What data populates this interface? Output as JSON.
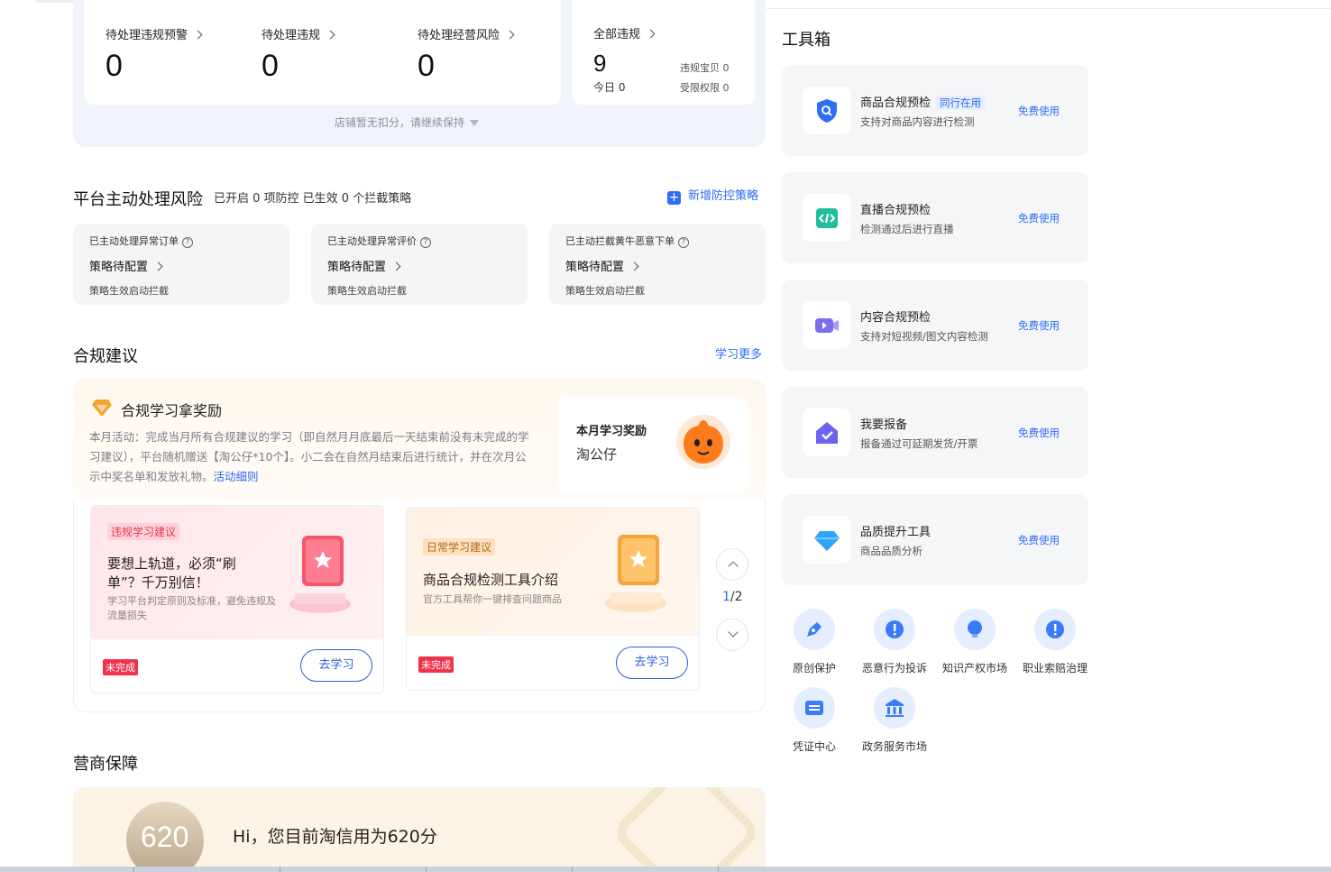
{
  "stats": {
    "items": [
      {
        "label": "待处理违规预警",
        "value": "0"
      },
      {
        "label": "待处理违规",
        "value": "0"
      },
      {
        "label": "待处理经营风险",
        "value": "0"
      }
    ],
    "all_violations": {
      "label": "全部违规",
      "value": "9",
      "today": "今日 0",
      "items_violation": "违规宝贝 0",
      "restricted": "受限权限 0"
    },
    "note": "店铺暂无扣分，请继续保持"
  },
  "platform": {
    "title": "平台主动处理风险",
    "subtitle": "已开启 0 项防控 已生效 0 个拦截策略",
    "add_link": "新增防控策略",
    "cards": [
      {
        "title": "已主动处理异常订单",
        "status": "策略待配置",
        "desc": "策略生效启动拦截"
      },
      {
        "title": "已主动处理异常评价",
        "status": "策略待配置",
        "desc": "策略生效启动拦截"
      },
      {
        "title": "已主动拦截黄牛恶意下单",
        "status": "策略待配置",
        "desc": "策略生效启动拦截"
      }
    ]
  },
  "suggestions": {
    "title": "合规建议",
    "more_link": "学习更多",
    "reward_title": "合规学习拿奖励",
    "reward_text": "本月活动：完成当月所有合规建议的学习（即自然月月底最后一天结束前没有未完成的学习建议），平台随机赠送【淘公仔*10个】。小二会在自然月结束后进行统计，并在次月公示中奖名单和发放礼物。",
    "reward_link": "活动细则",
    "monthly_label": "本月学习奖励",
    "monthly_value": "淘公仔",
    "cards": [
      {
        "tag": "违规学习建议",
        "title": "要想上轨道，必须“刷单”？千万别信！",
        "desc": "学习平台判定原则及标准，避免违规及流量损失",
        "status": "未完成",
        "button": "去学习"
      },
      {
        "tag": "日常学习建议",
        "title": "商品合规检测工具介绍",
        "desc": "官方工具帮你一键排查问题商品",
        "status": "未完成",
        "button": "去学习"
      }
    ],
    "pager_current": "1",
    "pager_total": "/2"
  },
  "business": {
    "title": "营商保障",
    "score": "620",
    "greeting": "Hi，您目前淘信用为620分"
  },
  "toolbox": {
    "title": "工具箱",
    "tools": [
      {
        "name": "商品合规预检",
        "tag": "同行在用",
        "desc": "支持对商品内容进行检测",
        "link": "免费使用",
        "icon": "shield-search-icon",
        "color": "#2d6cf6"
      },
      {
        "name": "直播合规预检",
        "tag": "",
        "desc": "检测通过后进行直播",
        "link": "免费使用",
        "icon": "code-icon",
        "color": "#1fbf9a"
      },
      {
        "name": "内容合规预检",
        "tag": "",
        "desc": "支持对短视频/图文内容检测",
        "link": "免费使用",
        "icon": "video-icon",
        "color": "#7b6cf0"
      },
      {
        "name": "我要报备",
        "tag": "",
        "desc": "报备通过可延期发货/开票",
        "link": "免费使用",
        "icon": "report-house-icon",
        "color": "#6c63f0"
      },
      {
        "name": "品质提升工具",
        "tag": "",
        "desc": "商品品质分析",
        "link": "免费使用",
        "icon": "diamond-icon",
        "color": "#2fa6f5"
      }
    ],
    "quick": [
      {
        "label": "原创保护",
        "icon": "pen-icon"
      },
      {
        "label": "恶意行为投诉",
        "icon": "alert-icon"
      },
      {
        "label": "知识产权市场",
        "icon": "bulb-icon"
      },
      {
        "label": "职业索赔治理",
        "icon": "alert-icon"
      },
      {
        "label": "凭证中心",
        "icon": "voucher-icon"
      },
      {
        "label": "政务服务市场",
        "icon": "government-icon"
      }
    ]
  }
}
